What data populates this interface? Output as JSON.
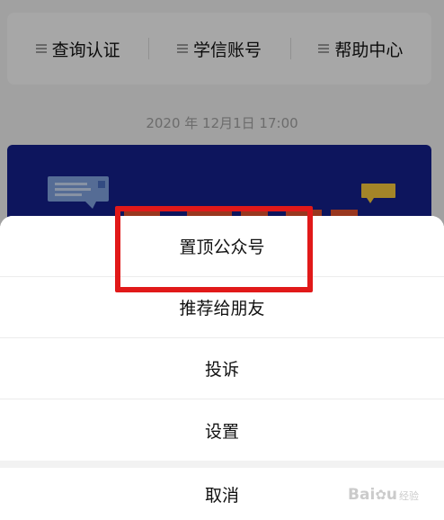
{
  "chat_menu": {
    "items": [
      {
        "label": "查询认证",
        "icon": "menu-lines-icon"
      },
      {
        "label": "学信账号",
        "icon": "menu-lines-icon"
      },
      {
        "label": "帮助中心",
        "icon": "menu-lines-icon"
      }
    ]
  },
  "timestamp": "2020 年 12月1日 17:00",
  "article_card": {
    "background_color": "#14208a",
    "icons": [
      "chat-bubble-icon",
      "sticky-note-icon"
    ]
  },
  "action_sheet": {
    "options": [
      {
        "label": "置顶公众号"
      },
      {
        "label": "推荐给朋友"
      },
      {
        "label": "投诉"
      },
      {
        "label": "设置"
      }
    ],
    "cancel_label": "取消"
  },
  "highlight": {
    "color": "#e11919",
    "target": "置顶公众号"
  },
  "watermark": {
    "text": "Bai",
    "paw_icon": "baidu-paw-icon",
    "text_after": "u",
    "sub": "经验"
  }
}
